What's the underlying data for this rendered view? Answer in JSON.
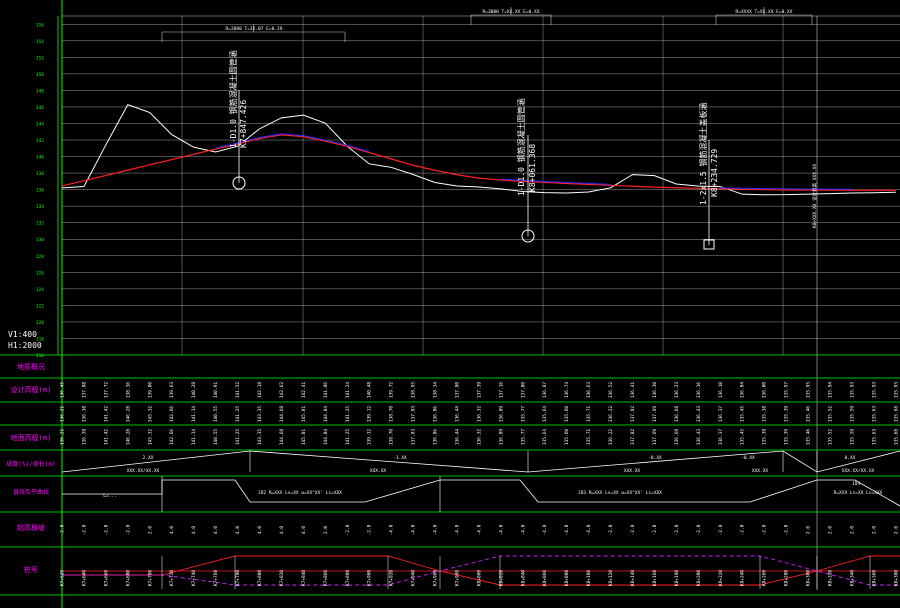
{
  "scale": {
    "vertical": "V1:400",
    "horizontal": "H1:2000"
  },
  "elevation_ticks": [
    "156",
    "154",
    "152",
    "150",
    "148",
    "146",
    "144",
    "142",
    "140",
    "138",
    "136",
    "134",
    "132",
    "130",
    "128",
    "126",
    "124",
    "122",
    "120",
    "118",
    "116"
  ],
  "curve_labels": [
    {
      "text": "R=2000  T=3X.07  E=0.29"
    },
    {
      "text": "R=3000  T=XX.XX  E=0.XX"
    },
    {
      "text": "R=XXXX  T=XX.XX  E=0.XX"
    }
  ],
  "structures": [
    {
      "line1": "1-D1.0 钢筋混凝土圆管涵",
      "line2": "K7+847.426",
      "type": "culvert"
    },
    {
      "line1": "1-D1.0 钢筋混凝土圆管涵",
      "line2": "K8+061.368",
      "type": "culvert"
    },
    {
      "line1": "1-2x1.5 钢筋混凝土盖板涵",
      "line2": "K8+234.729",
      "type": "box"
    },
    {
      "line1": "K8+XXX.XX  设计标高 XXX.XX",
      "line2": "",
      "type": "mark"
    }
  ],
  "row_labels": [
    "地质概况",
    "设计高程(m)",
    "地面高程(m)",
    "坡度(%)/坡长(m)",
    "直线及平曲线",
    "超高横坡",
    "桩号"
  ],
  "gradients": [
    {
      "text": "2.XX"
    },
    {
      "text": "XXX.XX/XX.XX"
    },
    {
      "text": "-1.XX"
    },
    {
      "text": "XXX.XX"
    },
    {
      "text": "-0.XX"
    },
    {
      "text": "XXX.XX"
    },
    {
      "text": "-0.XX"
    },
    {
      "text": "XXX.XX"
    },
    {
      "text": "0.XX"
    },
    {
      "text": "XXX.XX/XX.XX"
    }
  ],
  "alignment": [
    {
      "text": "L=..."
    },
    {
      "text": "JD2 R=XXX Ls=XX α=XX°XX' Lc=XXX"
    },
    {
      "text": "JD3 R=XXX Ls=XX α=XX°XX' Lc=XXX"
    },
    {
      "text": "JD4"
    },
    {
      "text": "R=XXX Ls=XX Lc=XXX"
    }
  ],
  "design_elev": [
    "136.45",
    "137.08",
    "137.72",
    "138.36",
    "139.00",
    "139.63",
    "140.28",
    "140.91",
    "141.52",
    "142.18",
    "142.62",
    "142.41",
    "141.86",
    "141.24",
    "140.48",
    "139.72",
    "138.95",
    "138.34",
    "137.80",
    "137.39",
    "137.16",
    "137.00",
    "136.87",
    "136.74",
    "136.63",
    "136.52",
    "136.41",
    "136.30",
    "136.23",
    "136.16",
    "136.10",
    "136.04",
    "136.00",
    "135.97",
    "135.95",
    "135.94",
    "135.93",
    "135.93",
    "135.93"
  ],
  "ground_elev": [
    "136.21",
    "136.38",
    "141.42",
    "146.28",
    "145.32",
    "142.66",
    "141.14",
    "140.55",
    "141.25",
    "143.35",
    "144.68",
    "145.01",
    "144.04",
    "141.25",
    "139.12",
    "138.70",
    "137.83",
    "136.86",
    "136.44",
    "136.32",
    "136.09",
    "135.77",
    "135.64",
    "135.60",
    "135.71",
    "136.22",
    "137.82",
    "137.69",
    "136.68",
    "136.43",
    "136.37",
    "135.45",
    "135.38",
    "135.39",
    "135.46",
    "135.52",
    "135.59",
    "135.63",
    "135.68"
  ],
  "superelevation": [
    "-2.0",
    "-2.0",
    "-2.0",
    "-2.0",
    "2.0",
    "4.0",
    "4.0",
    "4.0",
    "4.0",
    "4.0",
    "4.0",
    "4.0",
    "2.0",
    "-2.0",
    "-2.0",
    "-4.0",
    "-4.0",
    "-4.0",
    "-4.0",
    "-4.0",
    "-4.0",
    "-4.0",
    "-4.0",
    "-4.0",
    "-4.0",
    "-2.0",
    "-2.0",
    "-2.0",
    "-2.0",
    "-2.0",
    "-2.0",
    "-2.0",
    "-2.0",
    "-2.0",
    "2.0",
    "2.0",
    "2.0",
    "2.0",
    "2.0"
  ],
  "stations": [
    "K7+620",
    "K7+640",
    "K7+660",
    "K7+680",
    "K7+700",
    "K7+720",
    "K7+740",
    "K7+760",
    "K7+780",
    "K7+800",
    "K7+820",
    "K7+840",
    "K7+860",
    "K7+880",
    "K7+900",
    "K7+920",
    "K7+940",
    "K7+960",
    "K7+980",
    "K8+000",
    "K8+020",
    "K8+040",
    "K8+060",
    "K8+080",
    "K8+100",
    "K8+120",
    "K8+140",
    "K8+160",
    "K8+180",
    "K8+200",
    "K8+220",
    "K8+240",
    "K8+260",
    "K8+280",
    "K8+300",
    "K8+320",
    "K8+340",
    "K8+360",
    "K8+380"
  ],
  "colors": {
    "frame": "#00ff00",
    "grid": "#c8c8c8",
    "ground": "#ffffff",
    "design": "#ff2020",
    "vertical_curve": "#2a2aff",
    "text": "#ffffff",
    "label": "#ff00ff",
    "dashed": "#d020ff"
  },
  "chart_data": {
    "type": "line",
    "title": "",
    "xlabel": "",
    "ylabel": "",
    "ylim": [
      116,
      157
    ],
    "x": [
      "K7+620",
      "K7+640",
      "K7+660",
      "K7+680",
      "K7+700",
      "K7+720",
      "K7+740",
      "K7+760",
      "K7+780",
      "K7+800",
      "K7+820",
      "K7+840",
      "K7+860",
      "K7+880",
      "K7+900",
      "K7+920",
      "K7+940",
      "K7+960",
      "K7+980",
      "K8+000",
      "K8+020",
      "K8+040",
      "K8+060",
      "K8+080",
      "K8+100",
      "K8+120",
      "K8+140",
      "K8+160",
      "K8+180",
      "K8+200",
      "K8+220",
      "K8+240",
      "K8+260",
      "K8+280",
      "K8+300",
      "K8+320",
      "K8+340",
      "K8+360",
      "K8+380"
    ],
    "series": [
      {
        "name": "",
        "values": [
          136.21,
          136.38,
          141.42,
          146.28,
          145.32,
          142.66,
          141.14,
          140.55,
          141.25,
          143.35,
          144.68,
          145.01,
          144.04,
          141.25,
          139.12,
          138.7,
          137.83,
          136.86,
          136.44,
          136.32,
          136.09,
          135.77,
          135.64,
          135.6,
          135.71,
          136.22,
          137.82,
          137.69,
          136.68,
          136.43,
          136.37,
          135.45,
          135.38,
          135.39,
          135.46,
          135.52,
          135.59,
          135.63,
          135.68
        ]
      },
      {
        "name": "",
        "values": [
          136.45,
          137.08,
          137.72,
          138.36,
          139.0,
          139.63,
          140.28,
          140.91,
          141.52,
          142.18,
          142.62,
          142.41,
          141.86,
          141.24,
          140.48,
          139.72,
          138.95,
          138.34,
          137.8,
          137.39,
          137.16,
          137.0,
          136.87,
          136.74,
          136.63,
          136.52,
          136.41,
          136.3,
          136.23,
          136.16,
          136.1,
          136.04,
          136.0,
          135.97,
          135.95,
          135.94,
          135.93,
          135.93,
          135.93
        ]
      }
    ]
  }
}
